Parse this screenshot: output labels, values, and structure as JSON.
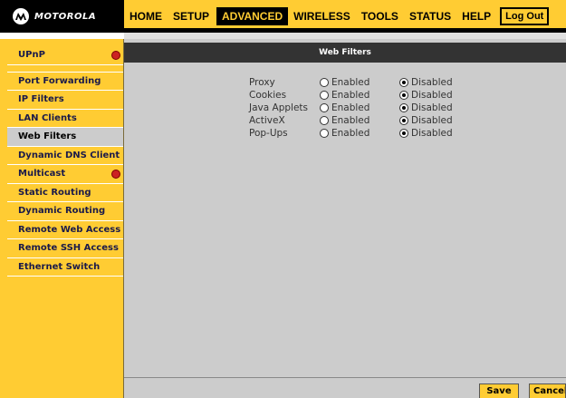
{
  "brand": {
    "logo_text": "MOTOROLA",
    "logo_icon": "motorola-batwing-icon"
  },
  "nav": {
    "items": [
      {
        "label": "HOME",
        "active": false
      },
      {
        "label": "SETUP",
        "active": false
      },
      {
        "label": "ADVANCED",
        "active": true
      },
      {
        "label": "WIRELESS",
        "active": false
      },
      {
        "label": "TOOLS",
        "active": false
      },
      {
        "label": "STATUS",
        "active": false
      },
      {
        "label": "HELP",
        "active": false
      }
    ],
    "logout_label": "Log Out"
  },
  "sidebar": {
    "items": [
      {
        "label": "UPnP",
        "alert": true,
        "active": false
      },
      {
        "label": "Port Forwarding",
        "alert": false,
        "active": false
      },
      {
        "label": "IP Filters",
        "alert": false,
        "active": false
      },
      {
        "label": "LAN Clients",
        "alert": false,
        "active": false
      },
      {
        "label": "Web Filters",
        "alert": false,
        "active": true
      },
      {
        "label": "Dynamic DNS Client",
        "alert": false,
        "active": false
      },
      {
        "label": "Multicast",
        "alert": true,
        "active": false
      },
      {
        "label": "Static Routing",
        "alert": false,
        "active": false
      },
      {
        "label": "Dynamic Routing",
        "alert": false,
        "active": false
      },
      {
        "label": "Remote Web Access",
        "alert": false,
        "active": false
      },
      {
        "label": "Remote SSH Access",
        "alert": false,
        "active": false
      },
      {
        "label": "Ethernet Switch",
        "alert": false,
        "active": false
      }
    ]
  },
  "panel": {
    "title": "Web Filters"
  },
  "filters": {
    "enabled_label": "Enabled",
    "disabled_label": "Disabled",
    "rows": [
      {
        "label": "Proxy",
        "value": "Disabled"
      },
      {
        "label": "Cookies",
        "value": "Disabled"
      },
      {
        "label": "Java Applets",
        "value": "Disabled"
      },
      {
        "label": "ActiveX",
        "value": "Disabled"
      },
      {
        "label": "Pop-Ups",
        "value": "Disabled"
      }
    ]
  },
  "buttons": {
    "save_label": "Save",
    "cancel_label": "Cancel"
  },
  "colors": {
    "accent": "#ffcc33",
    "header_bar": "#333333",
    "panel_bg": "#cccccc",
    "alert_dot": "#cc2222"
  }
}
